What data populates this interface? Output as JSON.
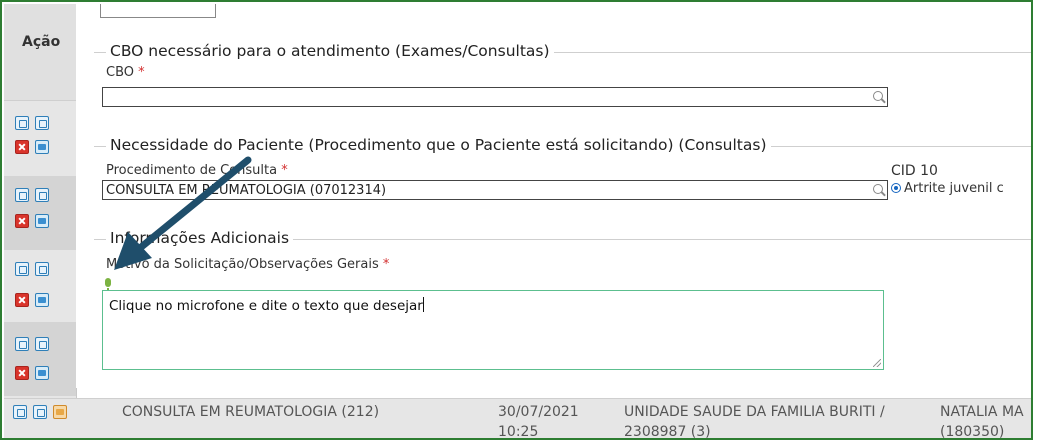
{
  "table": {
    "action_header": "Ação"
  },
  "sections": {
    "cbo": {
      "legend": "CBO necessário para o atendimento (Exames/Consultas)",
      "field_label": "CBO",
      "required_mark": "*",
      "value": ""
    },
    "necessidade": {
      "legend": "Necessidade do Paciente (Procedimento que o Paciente está solicitando) (Consultas)",
      "procedure_label": "Procedimento de Consulta",
      "required_mark": "*",
      "procedure_value": "CONSULTA EM REUMATOLOGIA (07012314)",
      "cid_label": "CID 10",
      "cid_option": "Artrite juvenil c"
    },
    "adicionais": {
      "legend": "Informações Adicionais",
      "motivo_label": "Motivo da Solicitação/Observações Gerais",
      "required_mark": "*",
      "motivo_text": "Clique no microfone e dite o texto que desejar"
    }
  },
  "bottom_row": {
    "procedure": "CONSULTA EM REUMATOLOGIA (212)",
    "date": "30/07/2021",
    "time": "10:25",
    "unit": "UNIDADE SAUDE DA FAMILIA BURITI /",
    "unit_code": "2308987 (3)",
    "professional": "NATALIA MA",
    "professional_code": "(180350)"
  },
  "colors": {
    "frame_border": "#2e7d32",
    "arrow": "#1f4e6b",
    "textarea_border": "#5cbf8f",
    "required": "#d32f2f"
  }
}
